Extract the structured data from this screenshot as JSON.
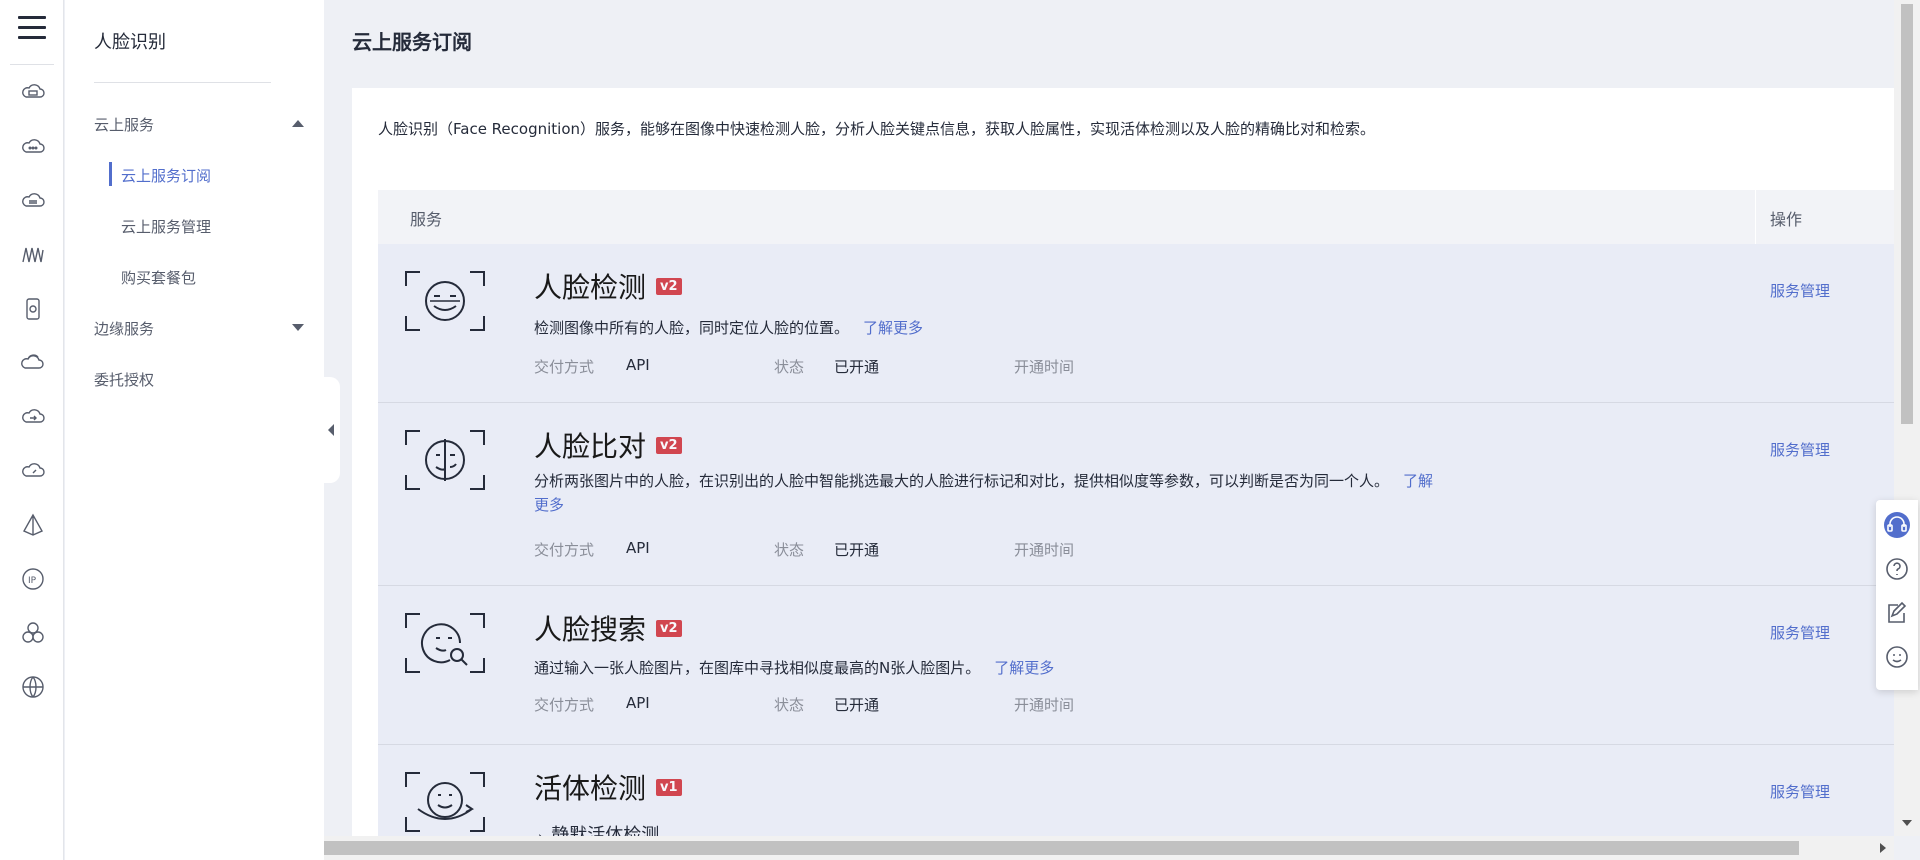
{
  "sidebar": {
    "title": "人脸识别",
    "groups": [
      {
        "label": "云上服务",
        "expanded": true
      },
      {
        "label": "边缘服务",
        "expanded": false
      },
      {
        "label": "委托授权"
      }
    ],
    "sub_items": [
      "云上服务订阅",
      "云上服务管理",
      "购买套餐包"
    ]
  },
  "main": {
    "page_title": "云上服务订阅",
    "intro": "人脸识别（Face Recognition）服务，能够在图像中快速检测人脸，分析人脸关键点信息，获取人脸属性，实现活体检测以及人脸的精确比对和检索。",
    "table": {
      "col_service": "服务",
      "col_action": "操作",
      "labels": {
        "delivery": "交付方式",
        "status": "状态",
        "open_time": "开通时间",
        "learn_more": "了解更多",
        "manage": "服务管理"
      },
      "rows": [
        {
          "name": "人脸检测",
          "version": "v2",
          "desc": "检测图像中所有的人脸，同时定位人脸的位置。",
          "delivery": "API",
          "status": "已开通"
        },
        {
          "name": "人脸比对",
          "version": "v2",
          "desc": "分析两张图片中的人脸，在识别出的人脸中智能挑选最大的人脸进行标记和对比，提供相似度等参数，可以判断是否为同一个人。",
          "delivery": "API",
          "status": "已开通"
        },
        {
          "name": "人脸搜索",
          "version": "v2",
          "desc": "通过输入一张人脸图片，在图库中寻找相似度最高的N张人脸图片。",
          "delivery": "API",
          "status": "已开通"
        },
        {
          "name": "活体检测",
          "version": "v1",
          "sub_item": "静默活体检测"
        }
      ]
    }
  },
  "colors": {
    "accent": "#526ecc",
    "badge": "#c7000b"
  }
}
